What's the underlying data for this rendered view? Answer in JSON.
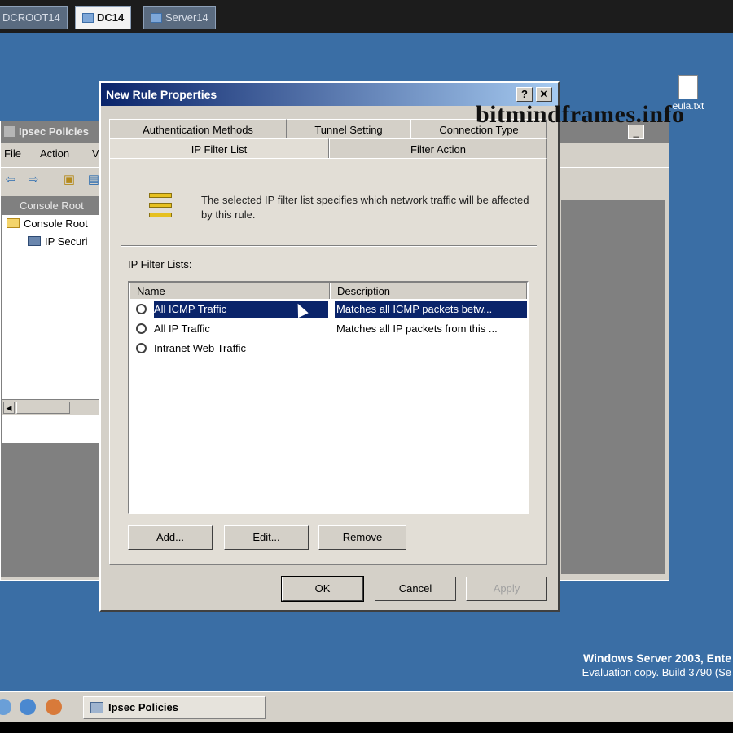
{
  "vm_tabs": [
    {
      "label": "DCROOT14",
      "active": false
    },
    {
      "label": "DC14",
      "active": true
    },
    {
      "label": "Server14",
      "active": false
    }
  ],
  "desktop": {
    "file_icon": {
      "icon": "text-file-icon",
      "label": "eula.txt"
    },
    "watermark": "bitmindframes.info",
    "os_brand_line1": "Windows Server 2003, Ente",
    "os_brand_line2": "Evaluation copy. Build 3790 (Se"
  },
  "mmc": {
    "title": "Ipsec Policies",
    "menu": [
      "File",
      "Action",
      "V"
    ],
    "tree_header": "Console Root",
    "tree_items": [
      "Console Root",
      "IP Securi"
    ]
  },
  "dialog": {
    "title": "New Rule Properties",
    "help_button": "?",
    "close_button": "✕",
    "tabs_back": [
      "Authentication Methods",
      "Tunnel Setting",
      "Connection Type"
    ],
    "tabs_front": [
      "IP Filter List",
      "Filter Action"
    ],
    "active_tab": "IP Filter List",
    "description": "The selected IP filter list specifies which network traffic will be affected by this rule.",
    "lists_label": "IP Filter Lists:",
    "columns": [
      "Name",
      "Description"
    ],
    "rows": [
      {
        "name": "All ICMP Traffic",
        "description": "Matches all ICMP packets betw...",
        "selected": true
      },
      {
        "name": "All IP Traffic",
        "description": "Matches all IP packets from this ...",
        "selected": false
      },
      {
        "name": "Intranet Web Traffic",
        "description": "",
        "selected": false
      }
    ],
    "buttons": {
      "add": "Add...",
      "edit": "Edit...",
      "remove": "Remove"
    },
    "footer": {
      "ok": "OK",
      "cancel": "Cancel",
      "apply": "Apply"
    }
  },
  "taskbar": {
    "task_label": "Ipsec Policies"
  },
  "colors": {
    "desktop": "#3a6ea5",
    "title_bar_start": "#0a246a",
    "title_bar_end": "#a6caf0",
    "selection": "#0a246a",
    "window_face": "#d4d0c8"
  }
}
